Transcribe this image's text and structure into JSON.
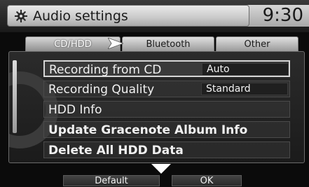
{
  "header": {
    "title": "Audio settings",
    "clock": "9:30"
  },
  "tabs": [
    {
      "label": "CD/HDD"
    },
    {
      "label": "Bluetooth"
    },
    {
      "label": "Other"
    }
  ],
  "menu": {
    "items": [
      {
        "label": "Recording from CD",
        "value": "Auto"
      },
      {
        "label": "Recording Quality",
        "value": "Standard"
      },
      {
        "label": "HDD Info"
      },
      {
        "label": "Update Gracenote Album Info"
      },
      {
        "label": "Delete All HDD Data"
      }
    ]
  },
  "footer": {
    "default_label": "Default",
    "ok_label": "OK"
  },
  "colors": {
    "header_bar": "#d9d9d9",
    "background": "#0b0b0b",
    "selection_border": "#d6d6d6"
  }
}
